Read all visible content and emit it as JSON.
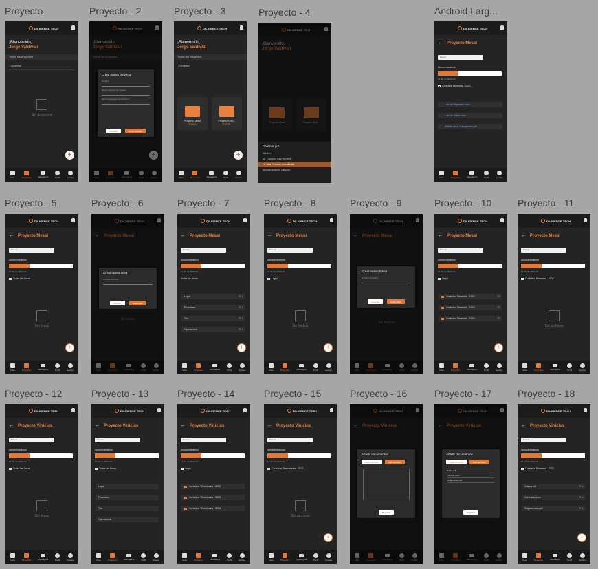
{
  "frames": [
    {
      "label": "Proyecto"
    },
    {
      "label": "Proyecto - 2"
    },
    {
      "label": "Proyecto - 3"
    },
    {
      "label": "Proyecto - 4"
    },
    {
      "label": "Android Larg..."
    },
    {
      "label": "Proyecto - 5"
    },
    {
      "label": "Proyecto - 6"
    },
    {
      "label": "Proyecto - 7"
    },
    {
      "label": "Proyecto - 8"
    },
    {
      "label": "Proyecto - 9"
    },
    {
      "label": "Proyecto - 10"
    },
    {
      "label": "Proyecto - 11"
    },
    {
      "label": "Proyecto - 12"
    },
    {
      "label": "Proyecto - 13"
    },
    {
      "label": "Proyecto - 14"
    },
    {
      "label": "Proyecto - 15"
    },
    {
      "label": "Proyecto - 16"
    },
    {
      "label": "Proyecto - 17"
    },
    {
      "label": "Proyecto - 18"
    }
  ],
  "app": {
    "brand": "DILIGENCE TECH",
    "welcome": "¡Bienvenido,",
    "user": "Jorge Valdivia!",
    "all_projects": "Todos los proyectos",
    "order": "Ordenar",
    "no_projects": "Sin proyectos",
    "no_areas": "Sin áreas",
    "no_folders": "Sin folders",
    "no_files": "Sin archivos",
    "search": "Buscar",
    "storage": "Almacenamiento",
    "storage_note": "12 Gb de 32Gb Gb",
    "all_areas": "Todas las Áreas",
    "project_messi": "Proyecto Messi",
    "project_vinicius": "Proyecto Vinicius",
    "fab": "+"
  },
  "nav": [
    {
      "label": "Inicio"
    },
    {
      "label": "Proyectos"
    },
    {
      "label": "Mensajería"
    },
    {
      "label": "Perfil"
    },
    {
      "label": "Ajustes"
    }
  ],
  "dialog_project": {
    "title": "Crear nuevo proyecto",
    "f1": "Nombre",
    "f2": "Modo Sujeción de Carpeta",
    "f3": "Modo Agrupación de Archivos",
    "cancel": "Cancelar",
    "create": "Crear proyecto"
  },
  "dialog_area": {
    "title": "Crear nueva área",
    "f1": "Nombre del área",
    "cancel": "Cancelar",
    "create": "Crear área"
  },
  "dialog_folder": {
    "title": "Crear nuevo folder",
    "f1": "Nombre del folder",
    "cancel": "Cancelar",
    "create": "Crear folder"
  },
  "dialog_docs": {
    "title": "Añadir documentos",
    "choose": "Elegir archivos",
    "upload": "Subir archivos",
    "register": "Registrar",
    "files": [
      "Ficha.pdf",
      "Informe.docx",
      "Reglamento.pdf"
    ]
  },
  "folders_p3": [
    {
      "name": "Proyecto Messi",
      "size": "Muy Gde."
    },
    {
      "name": "Proyecto Vinic...",
      "size": "5,43 Gb"
    }
  ],
  "sort_sheet": {
    "title": "Ordenar por",
    "options": [
      "Nombre",
      "M - Creación más Reciente",
      "H - Más Reciente Actualizado",
      "Almacenamiento Utilizado"
    ]
  },
  "areas": [
    "Legal",
    "Financiero",
    "Tim",
    "Operacional"
  ],
  "areas_13": [
    "Legal",
    "Financiero",
    "Tim",
    "Operacional"
  ],
  "contracts": [
    "Contratos Bimestral - 2022",
    "Contratos Bimestral - 2023",
    "Contratos Bimestral - 2024"
  ],
  "contracts_14": [
    "Contratos Trimestrales - 2022",
    "Contratos Trimestrales - 2023",
    "Contratos Trimestrales - 2024"
  ],
  "breadcrumb_legal": "Legal",
  "breadcrumb_contracts": "Contratos Bimestral - 2022",
  "breadcrumb_contracts_15": "Contratos Trimestrales - 2022",
  "files_android": [
    "Lista de Empleados.docx",
    "Lista de Gastos.docx",
    "Perfiles de los Trabajadores.pdf"
  ],
  "files_18": [
    "Gastos.pdf",
    "Contratos.docx",
    "Reglamentos.pdf"
  ],
  "storage_fill": 0.32
}
